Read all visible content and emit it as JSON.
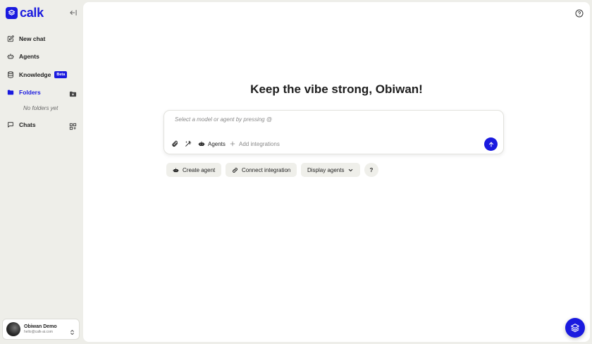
{
  "brand": {
    "name": "calk",
    "color": "#1a1adf"
  },
  "sidebar": {
    "collapse_icon": "collapse-sidebar-icon",
    "items": [
      {
        "label": "New chat",
        "icon": "edit-icon"
      },
      {
        "label": "Agents",
        "icon": "robot-icon"
      },
      {
        "label": "Knowledge",
        "icon": "database-icon",
        "badge": "Beta"
      },
      {
        "label": "Folders",
        "icon": "folder-icon",
        "active": true
      },
      {
        "label": "Chats",
        "icon": "chat-icon"
      }
    ],
    "folders_empty": "No folders yet"
  },
  "user": {
    "name": "Obiwan Demo",
    "email": "hello@calk-ai.com"
  },
  "main": {
    "greeting": "Keep the vibe strong, Obiwan!",
    "composer": {
      "placeholder": "Select a model or agent by pressing @",
      "value": "",
      "agents_label": "Agents",
      "integrations_label": "Add integrations"
    },
    "actions": {
      "create_agent": "Create agent",
      "connect_integration": "Connect integration",
      "display_agents": "Display agents",
      "help": "?"
    }
  }
}
